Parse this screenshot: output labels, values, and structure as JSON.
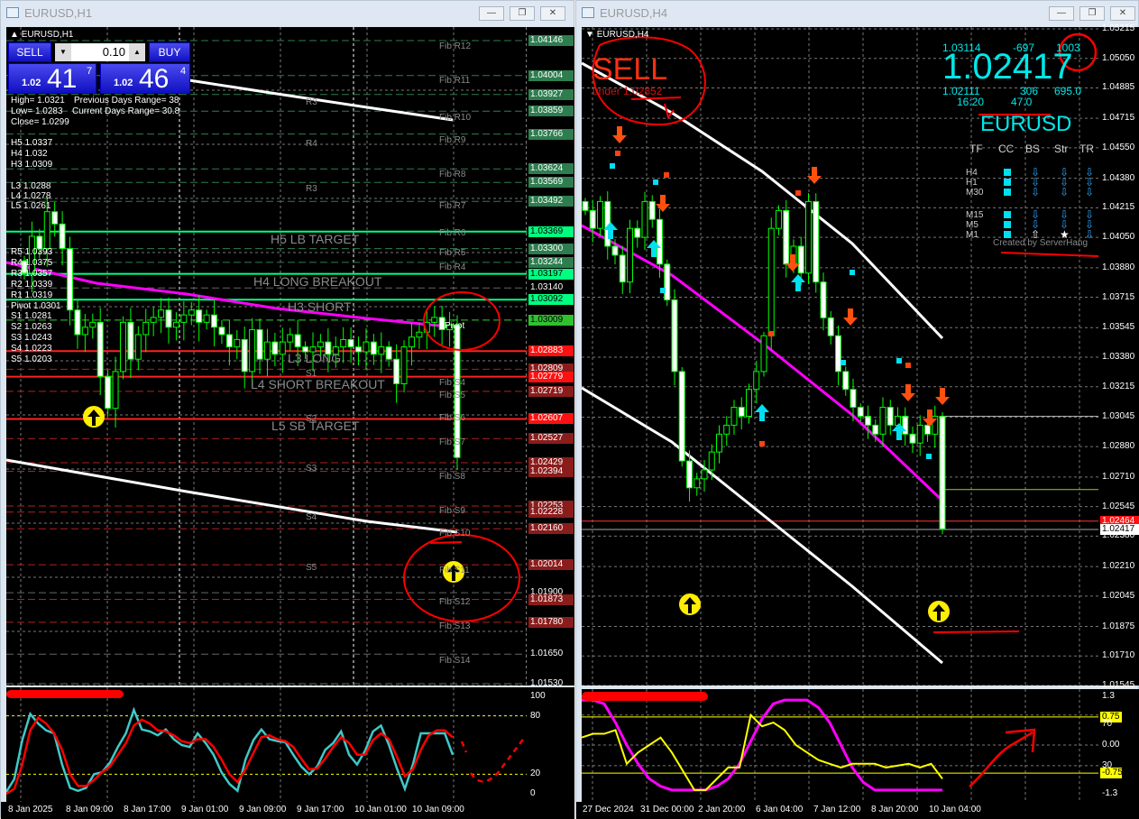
{
  "left": {
    "title": "EURUSD,H1",
    "chart_label": "EURUSD,H1",
    "trade": {
      "sell": "SELL",
      "buy": "BUY",
      "lot": "0.10",
      "sell_big": "41",
      "sell_small": "1.02",
      "sell_sup": "7",
      "buy_big": "46",
      "buy_small": "1.02",
      "buy_sup": "4"
    },
    "stats": [
      "High= 1.0321",
      "Previous Days Range= 38",
      "Low= 1.0283",
      "Current Days Range= 30.8",
      "Close= 1.0299"
    ],
    "hl": [
      "H5 1.0337",
      "H4 1.032",
      "H3 1.0309",
      "L3 1.0288",
      "L4 1.0278",
      "L5 1.0261"
    ],
    "pivots": [
      "R5 1.0393",
      "R4 1.0375",
      "R3 1.0357",
      "R2 1.0339",
      "R1 1.0319",
      "Pivot 1.0301",
      "S1 1.0281",
      "S2 1.0263",
      "S3 1.0243",
      "S4 1.0223",
      "S5 1.0203"
    ],
    "targets": [
      "H5 LB TARGET",
      "H4 LONG BREAKOUT",
      "H3 SHORT",
      "L3 LONG",
      "L4 SHORT BREAKOUT",
      "L5 SB TARGET"
    ],
    "pivot_marks": [
      "R3",
      "R4",
      "R3",
      "R1",
      "S1",
      "S2",
      "S3",
      "S4",
      "S5",
      "Pivot"
    ],
    "fibs": [
      [
        "Fib R12",
        1.0412
      ],
      [
        "Fib R11",
        1.0398
      ],
      [
        "Fib R10",
        1.0383
      ],
      [
        "Fib R9",
        1.0374
      ],
      [
        "Fib R8",
        1.036
      ],
      [
        "Fib R7",
        1.0347
      ],
      [
        "Fib R6",
        1.0336
      ],
      [
        "Fib R5",
        1.0328
      ],
      [
        "Fib R4",
        1.0322
      ],
      [
        "Fib S4",
        1.0275
      ],
      [
        "Fib S5",
        1.027
      ],
      [
        "Fib S6",
        1.0261
      ],
      [
        "Fib S7",
        1.0251
      ],
      [
        "Fib S8",
        1.0237
      ],
      [
        "Fib S9",
        1.0223
      ],
      [
        "Fib S10",
        1.0214
      ],
      [
        "Fib S11",
        1.0199
      ],
      [
        "Fib S12",
        1.0186
      ],
      [
        "Fib S13",
        1.0176
      ],
      [
        "Fib S14",
        1.0162
      ]
    ],
    "price_range": [
      1.0153,
      1.04146
    ],
    "price_labels": [
      [
        "1.04146",
        "g"
      ],
      [
        "1.04004",
        "g"
      ],
      [
        "1.03927",
        "g"
      ],
      [
        "1.03859",
        "g"
      ],
      [
        "1.03766",
        "g"
      ],
      [
        "1.03624",
        "g"
      ],
      [
        "1.03569",
        "g"
      ],
      [
        "1.03492",
        "g"
      ],
      [
        "1.03369",
        "b"
      ],
      [
        "1.03300",
        "g"
      ],
      [
        "1.03244",
        "g"
      ],
      [
        "1.03197",
        "b"
      ],
      [
        "1.03140",
        "p"
      ],
      [
        "1.03092",
        "b"
      ],
      [
        "1.03009",
        "l"
      ],
      [
        "1.02883",
        "r"
      ],
      [
        "1.02809",
        "d"
      ],
      [
        "1.02779",
        "r"
      ],
      [
        "1.02719",
        "d"
      ],
      [
        "1.02607",
        "r"
      ],
      [
        "1.02527",
        "d"
      ],
      [
        "1.02429",
        "d"
      ],
      [
        "1.02394",
        "d"
      ],
      [
        "1.02253",
        "d"
      ],
      [
        "1.02228",
        "d"
      ],
      [
        "1.02160",
        "d"
      ],
      [
        "1.02014",
        "d"
      ],
      [
        "1.01900",
        "p"
      ],
      [
        "1.01873",
        "d"
      ],
      [
        "1.01780",
        "d"
      ],
      [
        "1.01650",
        "p"
      ],
      [
        "1.01530",
        "p"
      ]
    ],
    "closes": [
      1.032,
      1.0335,
      1.033,
      1.0345,
      1.034,
      1.033,
      1.0305,
      1.0295,
      1.0298,
      1.03,
      1.0278,
      1.0265,
      1.028,
      1.03,
      1.0285,
      1.0295,
      1.03,
      1.0302,
      1.0305,
      1.0298,
      1.03,
      1.0303,
      1.0305,
      1.03,
      1.0303,
      1.0298,
      1.0295,
      1.029,
      1.0293,
      1.028,
      1.0297,
      1.0285,
      1.0292,
      1.0287,
      1.0292,
      1.0295,
      1.029,
      1.0288,
      1.029,
      1.0292,
      1.0287,
      1.029,
      1.0293,
      1.029,
      1.0288,
      1.0292,
      1.0287,
      1.029,
      1.0285,
      1.0275,
      1.029,
      1.0294,
      1.0296,
      1.03,
      1.0302,
      1.0297,
      1.0299,
      1.0245
    ],
    "osc_axis": [
      "100",
      "80",
      "20",
      "0"
    ],
    "stoch_main": [
      2,
      15,
      55,
      82,
      72,
      65,
      62,
      30,
      6,
      3,
      6,
      20,
      22,
      32,
      48,
      62,
      86,
      66,
      64,
      60,
      66,
      56,
      50,
      48,
      62,
      52,
      40,
      22,
      10,
      3,
      35,
      55,
      66,
      56,
      54,
      53,
      40,
      28,
      20,
      28,
      45,
      52,
      64,
      40,
      30,
      44,
      64,
      70,
      50,
      26,
      5,
      30,
      62,
      62,
      62,
      62,
      40
    ],
    "stoch_signal": [
      0,
      5,
      30,
      65,
      78,
      72,
      62,
      45,
      20,
      8,
      8,
      14,
      22,
      28,
      40,
      52,
      70,
      76,
      72,
      65,
      64,
      60,
      54,
      52,
      56,
      56,
      48,
      35,
      20,
      12,
      25,
      42,
      58,
      60,
      56,
      54,
      48,
      36,
      25,
      26,
      36,
      48,
      58,
      52,
      40,
      40,
      55,
      62,
      56,
      38,
      18,
      25,
      45,
      60,
      65,
      65,
      58
    ],
    "times": [
      "8 Jan 2025",
      "8 Jan 09:00",
      "8 Jan 17:00",
      "9 Jan 01:00",
      "9 Jan 09:00",
      "9 Jan 17:00",
      "10 Jan 01:00",
      "10 Jan 09:00"
    ]
  },
  "right": {
    "title": "EURUSD,H4",
    "chart_label": "EURUSD,H4",
    "annotation": {
      "sell": "SELL",
      "under": "under 1.02852"
    },
    "info": {
      "top_left": "1.03114",
      "top_mid": "-697",
      "top_right": "1003",
      "price": "1.02417",
      "bot_left": "1.02111",
      "bot_mid": "306",
      "bot_right": "695.0",
      "time": "16:20",
      "val": "47.0",
      "symbol": "EURUSD"
    },
    "table": {
      "headers": [
        "TF",
        "CC",
        "BS",
        "Str",
        "TR"
      ],
      "rows": [
        [
          "H4",
          "down",
          "down",
          "down"
        ],
        [
          "H1",
          "down",
          "down",
          "down"
        ],
        [
          "M30",
          "down",
          "down",
          "down"
        ],
        [
          "M15",
          "down",
          "down",
          "down"
        ],
        [
          "M5",
          "down",
          "down",
          "down"
        ],
        [
          "M1",
          "up",
          "star",
          "down"
        ]
      ],
      "credit": "Created by ServerHang"
    },
    "price_range": [
      1.01545,
      1.05215
    ],
    "price_labels": [
      "1.05215",
      "1.05050",
      "1.04885",
      "1.04715",
      "1.04550",
      "1.04380",
      "1.04215",
      "1.04050",
      "1.03880",
      "1.03715",
      "1.03545",
      "1.03380",
      "1.03215",
      "1.03045",
      "1.02880",
      "1.02710",
      "1.02545",
      "1.02380",
      "1.02210",
      "1.02045",
      "1.01875",
      "1.01710",
      "1.01545"
    ],
    "ask_label": "1.02464",
    "bid_label": "1.02417",
    "closes": [
      1.042,
      1.041,
      1.0425,
      1.04,
      1.0395,
      1.038,
      1.041,
      1.0405,
      1.0425,
      1.0415,
      1.039,
      1.037,
      1.033,
      1.028,
      1.0265,
      1.027,
      1.0275,
      1.0285,
      1.0295,
      1.03,
      1.031,
      1.0305,
      1.032,
      1.033,
      1.035,
      1.041,
      1.042,
      1.039,
      1.04,
      1.0385,
      1.0425,
      1.038,
      1.036,
      1.035,
      1.033,
      1.032,
      1.031,
      1.0305,
      1.03,
      1.0295,
      1.031,
      1.03,
      1.0305,
      1.0295,
      1.029,
      1.03,
      1.0295,
      1.0305,
      1.0242
    ],
    "osc_axis": [
      "1.3",
      "0.75",
      "70",
      "0.00",
      "30",
      "-0.75",
      "-1.3"
    ],
    "osc_range": [
      -1.3,
      1.3
    ],
    "magenta": [
      1.2,
      1.2,
      1.1,
      0.6,
      0,
      -0.5,
      -0.9,
      -1.1,
      -1.2,
      -1.2,
      -1.2,
      -1.2,
      -1.1,
      -0.9,
      -0.5,
      0.1,
      0.7,
      1.1,
      1.2,
      1.2,
      1.2,
      1.0,
      0.6,
      0,
      -0.6,
      -1.0,
      -1.2,
      -1.2,
      -1.2,
      -1.2,
      -1.2,
      -1.2,
      -1.2
    ],
    "yellow": [
      0.2,
      0.3,
      0.3,
      0.4,
      -0.5,
      -0.2,
      0,
      0.2,
      -0.2,
      -0.7,
      -1.2,
      -1.2,
      -0.9,
      -0.6,
      -0.6,
      0.8,
      0.5,
      0.6,
      0.4,
      0,
      -0.2,
      -0.4,
      -0.5,
      -0.6,
      -0.5,
      -0.5,
      -0.5,
      -0.6,
      -0.55,
      -0.5,
      -0.6,
      -0.5,
      -0.9
    ],
    "times": [
      "27 Dec 2024",
      "31 Dec 00:00",
      "2 Jan 20:00",
      "6 Jan 04:00",
      "7 Jan 12:00",
      "8 Jan 20:00",
      "10 Jan 04:00"
    ]
  },
  "colors": {
    "bull": "#ffffff",
    "wick": "#00ff00",
    "magenta": "#ff00ff",
    "cyan": "#00ffff",
    "stoch_main": "#40c8c8",
    "stoch_signal": "#ff0000",
    "fib_green": "#2e7d4f",
    "level_red": "#d00000"
  }
}
